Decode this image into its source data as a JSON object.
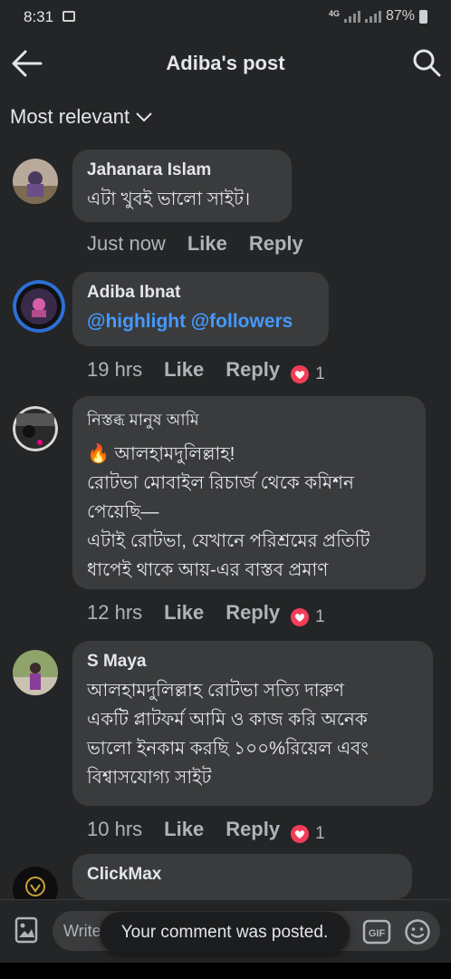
{
  "status": {
    "time": "8:31",
    "network": "4G",
    "battery": "87%"
  },
  "header": {
    "title": "Adiba's post"
  },
  "sort": {
    "label": "Most relevant"
  },
  "comments": [
    {
      "author": "Jahanara Islam",
      "text": "এটা খুবই ভালো সাইট।",
      "time": "Just now",
      "like": "Like",
      "reply": "Reply"
    },
    {
      "author": "Adiba Ibnat",
      "mention1": "@highlight",
      "mention2": "@followers",
      "time": "19 hrs",
      "like": "Like",
      "reply": "Reply",
      "reactions": "1"
    },
    {
      "author": "নিস্তব্ধ মানুষ আমি",
      "emoji": "🔥",
      "line1": "আলহামদুলিল্লাহ!",
      "line2": "রোটভা মোবাইল রিচার্জ থেকে কমিশন",
      "line3": "পেয়েছি—",
      "line4": "এটাই রোটভা, যেখানে পরিশ্রমের প্রতিটি",
      "line5": "ধাপেই থাকে আয়-এর বাস্তব প্রমাণ",
      "time": "12 hrs",
      "like": "Like",
      "reply": "Reply",
      "reactions": "1"
    },
    {
      "author": "S Maya",
      "line1": "আলহামদুলিল্লাহ রোটভা সত্যি দারুণ",
      "line2": "একটি প্লাটফর্ম আমি ও কাজ করি অনেক",
      "line3": "ভালো ইনকাম করছি ১০০%রিয়েল এবং",
      "line4": "বিশ্বাসযোগ্য সাইট",
      "time": "10 hrs",
      "like": "Like",
      "reply": "Reply",
      "reactions": "1"
    },
    {
      "author": "ClickMax"
    }
  ],
  "composer": {
    "placeholder": "Write"
  },
  "toast": {
    "text": "Your comment was posted."
  },
  "colors": {
    "background": "#242526",
    "bubble": "#3a3b3c",
    "mention": "#4599ff",
    "heart": "#f33e58"
  }
}
